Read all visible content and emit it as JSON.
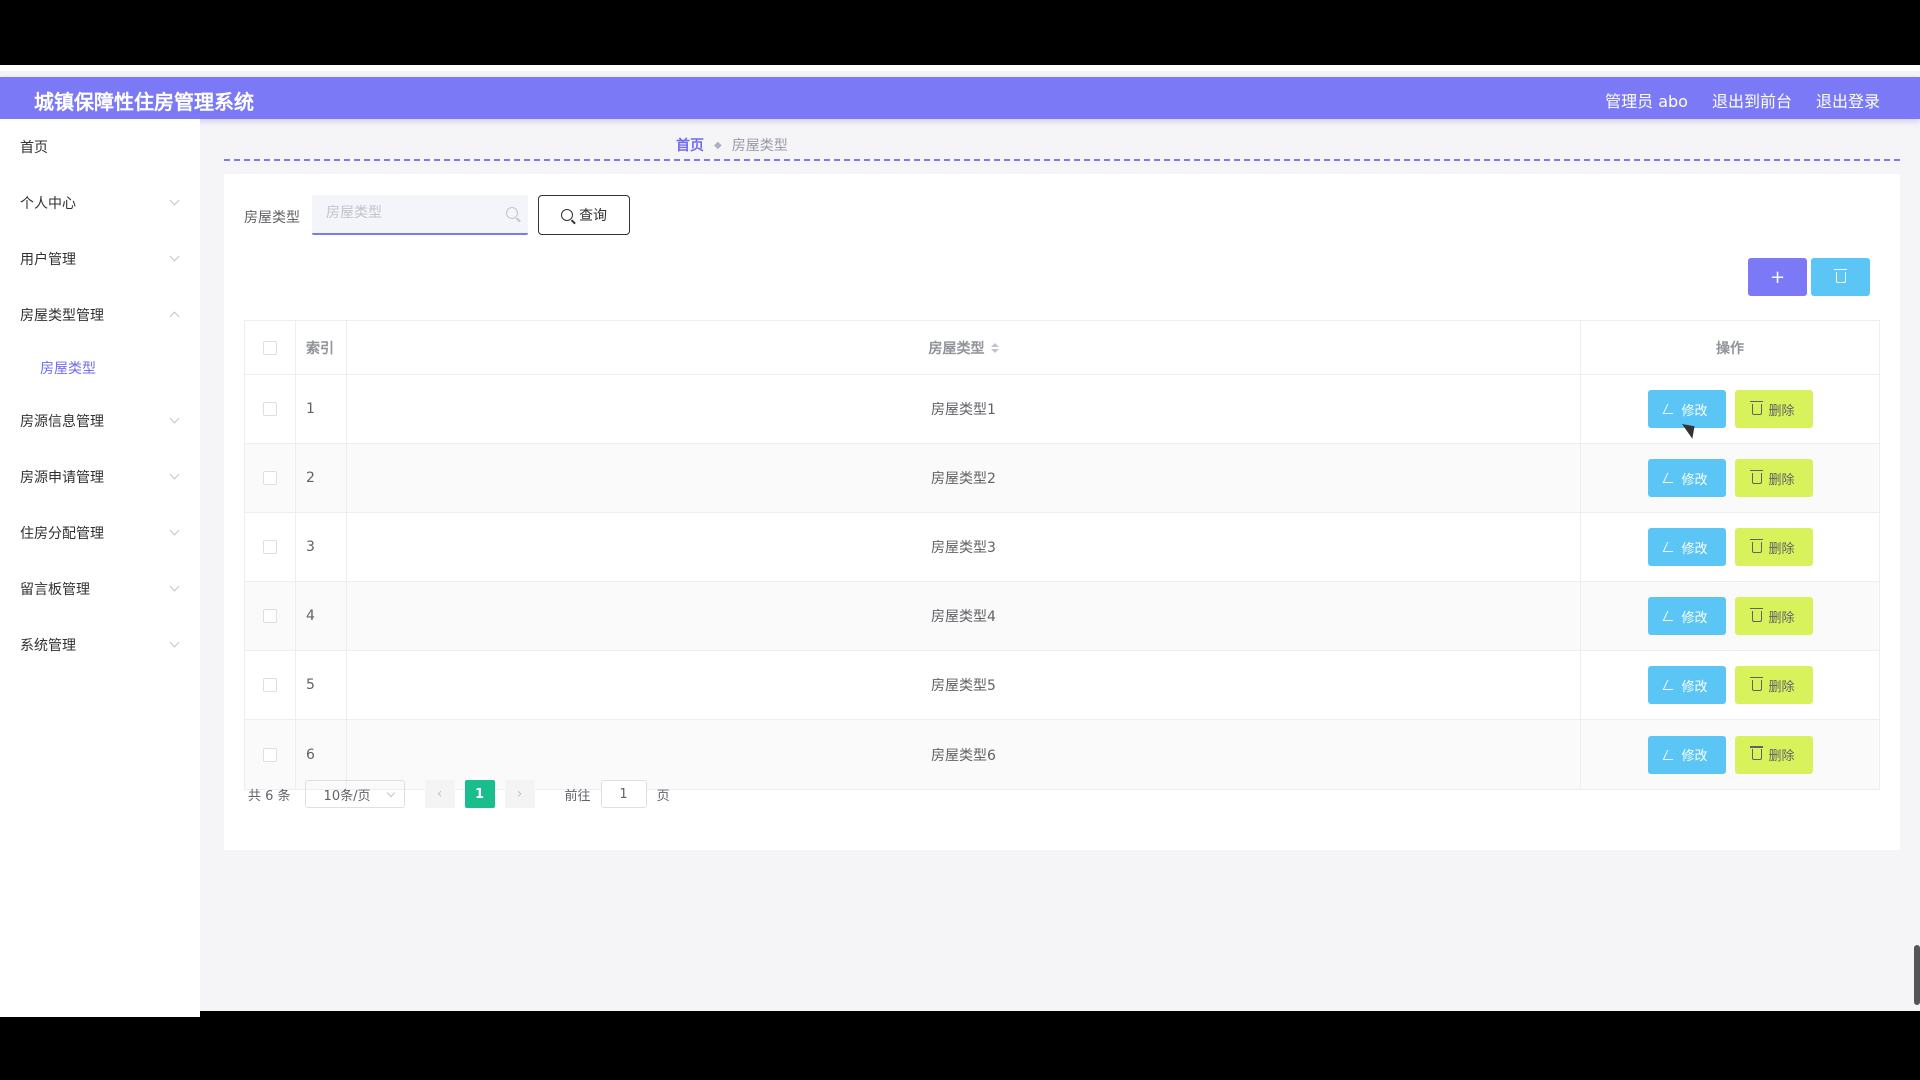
{
  "header": {
    "title": "城镇保障性住房管理系统",
    "user_label": "管理员 abo",
    "back_front_label": "退出到前台",
    "logout_label": "退出登录"
  },
  "sidebar": {
    "items": [
      {
        "label": "首页"
      },
      {
        "label": "个人中心"
      },
      {
        "label": "用户管理"
      },
      {
        "label": "房屋类型管理",
        "sub": "房屋类型"
      },
      {
        "label": "房源信息管理"
      },
      {
        "label": "房源申请管理"
      },
      {
        "label": "住房分配管理"
      },
      {
        "label": "留言板管理"
      },
      {
        "label": "系统管理"
      }
    ]
  },
  "breadcrumb": {
    "home": "首页",
    "current": "房屋类型"
  },
  "search": {
    "label": "房屋类型",
    "placeholder": "房屋类型",
    "button_label": "查询"
  },
  "toolbar": {
    "add_symbol": "+"
  },
  "table": {
    "headers": {
      "index": "索引",
      "type": "房屋类型",
      "ops": "操作"
    },
    "edit_label": "修改",
    "delete_label": "删除",
    "rows": [
      {
        "index": "1",
        "type": "房屋类型1"
      },
      {
        "index": "2",
        "type": "房屋类型2"
      },
      {
        "index": "3",
        "type": "房屋类型3"
      },
      {
        "index": "4",
        "type": "房屋类型4"
      },
      {
        "index": "5",
        "type": "房屋类型5"
      },
      {
        "index": "6",
        "type": "房屋类型6"
      }
    ]
  },
  "pagination": {
    "total_label": "共 6 条",
    "page_size": "10条/页",
    "prev": "‹",
    "next": "›",
    "current_page": "1",
    "goto_label": "前往",
    "goto_value": "1",
    "page_suffix": "页"
  },
  "colors": {
    "accent": "#7b79f5",
    "edit": "#5bc6f5",
    "delete": "#d8f25c",
    "page_active": "#19be8c"
  }
}
